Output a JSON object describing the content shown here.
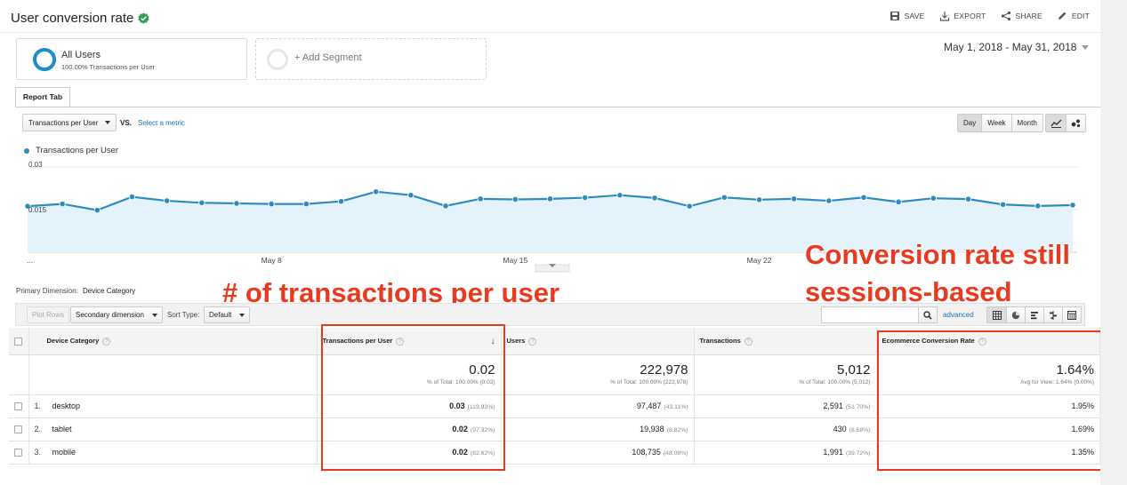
{
  "header": {
    "title": "User conversion rate",
    "actions": [
      {
        "label": "SAVE",
        "icon": "save-icon"
      },
      {
        "label": "EXPORT",
        "icon": "export-icon"
      },
      {
        "label": "SHARE",
        "icon": "share-icon"
      },
      {
        "label": "EDIT",
        "icon": "pencil-icon"
      }
    ]
  },
  "segments": {
    "active": {
      "name": "All Users",
      "sub": "100.00% Transactions per User"
    },
    "add_label": "+ Add Segment"
  },
  "date_range": "May 1, 2018 - May 31, 2018",
  "report_tab": "Report Tab",
  "metric_controls": {
    "metric": "Transactions per User",
    "vs": "VS.",
    "select_metric": "Select a metric",
    "periods": [
      "Day",
      "Week",
      "Month"
    ],
    "selected_period": "Day"
  },
  "chart_data": {
    "type": "line",
    "series": [
      {
        "name": "Transactions per User",
        "values": [
          0.0162,
          0.017,
          0.0148,
          0.0195,
          0.0181,
          0.0174,
          0.0172,
          0.017,
          0.017,
          0.0179,
          0.0213,
          0.0201,
          0.0163,
          0.0188,
          0.0186,
          0.0188,
          0.0192,
          0.0201,
          0.0191,
          0.0162,
          0.0193,
          0.0185,
          0.0188,
          0.0181,
          0.0193,
          0.0177,
          0.019,
          0.0187,
          0.0168,
          0.0163,
          0.0166
        ]
      }
    ],
    "x": [
      "May 1",
      "May 2",
      "May 3",
      "May 4",
      "May 5",
      "May 6",
      "May 7",
      "May 8",
      "May 9",
      "May 10",
      "May 11",
      "May 12",
      "May 13",
      "May 14",
      "May 15",
      "May 16",
      "May 17",
      "May 18",
      "May 19",
      "May 20",
      "May 21",
      "May 22",
      "May 23",
      "May 24",
      "May 25",
      "May 26",
      "May 27",
      "May 28",
      "May 29",
      "May 30",
      "May 31"
    ],
    "x_tick_labels": [
      "...",
      "May 8",
      "May 15",
      "May 22"
    ],
    "y_tick_labels": [
      "0.03",
      "0.015"
    ],
    "ylim": [
      0,
      0.03
    ],
    "color": "#2e8bc0",
    "fill": "#e4f2fb"
  },
  "annotations": {
    "transactions": "# of transactions per user",
    "conversion_line1": "Conversion rate still",
    "conversion_line2": "sessions-based",
    "color": "#e83a1f"
  },
  "primary_dimension": {
    "label": "Primary Dimension:",
    "value": "Device Category"
  },
  "toolbar": {
    "plot_rows": "Plot Rows",
    "secondary_dimension": "Secondary dimension",
    "sort_type_label": "Sort Type:",
    "sort_type_value": "Default",
    "advanced": "advanced"
  },
  "table": {
    "columns": [
      "Device Category",
      "Transactions per User",
      "Users",
      "Transactions",
      "Ecommerce Conversion Rate"
    ],
    "totals": {
      "tpu": "0.02",
      "tpu_sub": "% of Total: 100.00% (0.02)",
      "users": "222,978",
      "users_sub": "% of Total: 100.00% (222,978)",
      "transactions": "5,012",
      "transactions_sub": "% of Total: 100.00% (5,012)",
      "ecr": "1.64%",
      "ecr_sub": "Avg for View: 1.64% (0.00%)"
    },
    "rows": [
      {
        "num": "1.",
        "device": "desktop",
        "tpu": "0.03",
        "tpu_pct": "(119.93%)",
        "users": "97,487",
        "users_pct": "(43.11%)",
        "transactions": "2,591",
        "transactions_pct": "(51.70%)",
        "ecr": "1.95%"
      },
      {
        "num": "2.",
        "device": "tablet",
        "tpu": "0.02",
        "tpu_pct": "(97.32%)",
        "users": "19,938",
        "users_pct": "(8.82%)",
        "transactions": "430",
        "transactions_pct": "(8.58%)",
        "ecr": "1.69%"
      },
      {
        "num": "3.",
        "device": "mobile",
        "tpu": "0.02",
        "tpu_pct": "(82.62%)",
        "users": "108,735",
        "users_pct": "(48.08%)",
        "transactions": "1,991",
        "transactions_pct": "(39.72%)",
        "ecr": "1.35%"
      }
    ]
  }
}
